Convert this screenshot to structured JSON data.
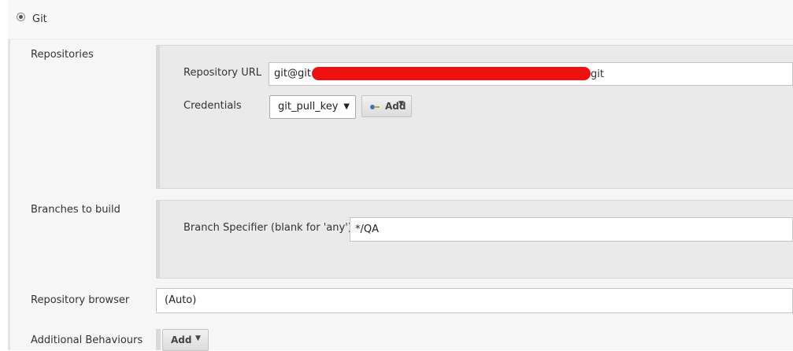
{
  "scm": {
    "option_label": "Git"
  },
  "repositories": {
    "label": "Repositories",
    "url_label": "Repository URL",
    "url_prefix": "git@git",
    "url_suffix": "git",
    "credentials_label": "Credentials",
    "credentials_selected": "git_pull_key",
    "add_button_label": "Add"
  },
  "branches": {
    "label": "Branches to build",
    "specifier_label": "Branch Specifier (blank for 'any')",
    "specifier_value": "*/QA"
  },
  "browser": {
    "label": "Repository browser",
    "selected": "(Auto)"
  },
  "behaviours": {
    "label": "Additional Behaviours",
    "add_button_label": "Add"
  },
  "colors": {
    "redaction": "#ee1111",
    "panel": "#eaeaea"
  }
}
